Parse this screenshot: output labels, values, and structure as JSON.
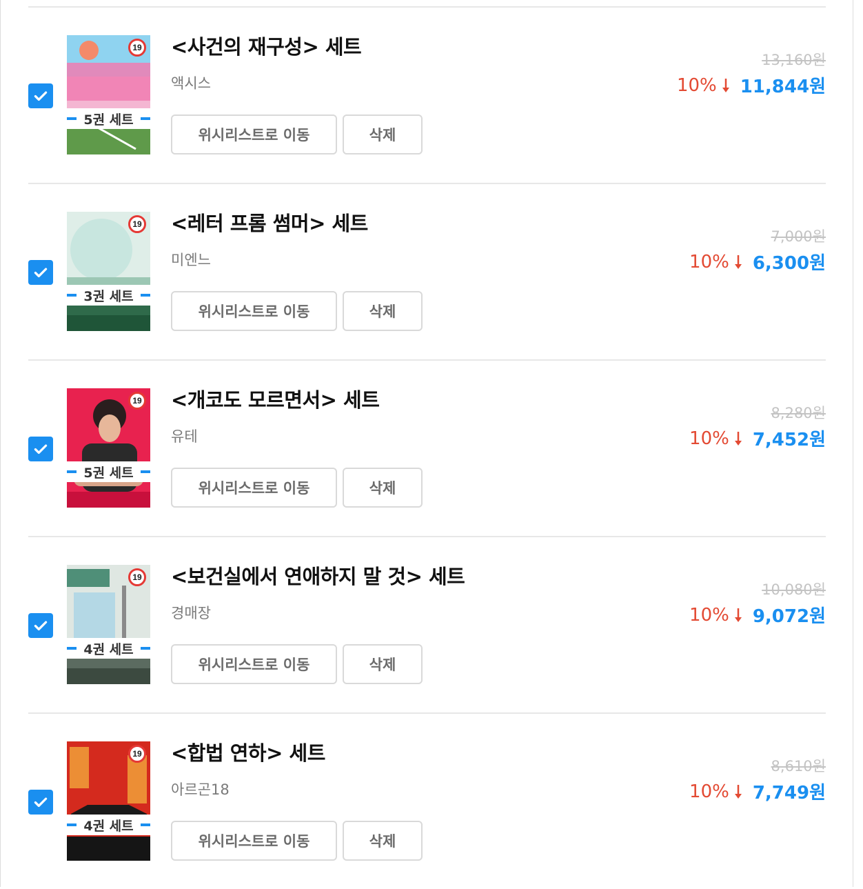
{
  "colors": {
    "accent": "#1a8ff0",
    "discount": "#e34a33",
    "age_badge_ring": "#e53935",
    "original_price": "#c3c3c3"
  },
  "icons": {
    "checkbox": "checkmark-icon",
    "discount_arrow": "arrow-down-icon",
    "age_rating": "age-19-badge"
  },
  "cart": {
    "items": [
      {
        "title": "<사건의 재구성> 세트",
        "author": "액시스",
        "age_rating": "19",
        "set_label": "5권 세트",
        "wishlist_label": "위시리스트로 이동",
        "delete_label": "삭제",
        "original_price": "13,160원",
        "discount": "10%",
        "price": "11,844원",
        "checked": true
      },
      {
        "title": "<레터 프롬 썸머> 세트",
        "author": "미엔느",
        "age_rating": "19",
        "set_label": "3권 세트",
        "wishlist_label": "위시리스트로 이동",
        "delete_label": "삭제",
        "original_price": "7,000원",
        "discount": "10%",
        "price": "6,300원",
        "checked": true
      },
      {
        "title": "<개코도 모르면서> 세트",
        "author": "유테",
        "age_rating": "19",
        "set_label": "5권 세트",
        "wishlist_label": "위시리스트로 이동",
        "delete_label": "삭제",
        "original_price": "8,280원",
        "discount": "10%",
        "price": "7,452원",
        "checked": true
      },
      {
        "title": "<보건실에서 연애하지 말 것> 세트",
        "author": "경매장",
        "age_rating": "19",
        "set_label": "4권 세트",
        "wishlist_label": "위시리스트로 이동",
        "delete_label": "삭제",
        "original_price": "10,080원",
        "discount": "10%",
        "price": "9,072원",
        "checked": true
      },
      {
        "title": "<합법 연하> 세트",
        "author": "아르곤18",
        "age_rating": "19",
        "set_label": "4권 세트",
        "wishlist_label": "위시리스트로 이동",
        "delete_label": "삭제",
        "original_price": "8,610원",
        "discount": "10%",
        "price": "7,749원",
        "checked": true
      }
    ]
  }
}
